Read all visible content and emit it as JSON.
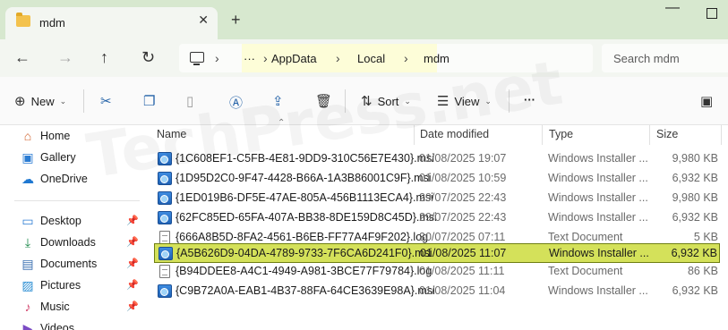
{
  "window": {
    "tab_title": "mdm",
    "close_tab": "✕",
    "new_tab": "+",
    "minimize": "—"
  },
  "nav": {
    "back": "←",
    "forward": "→",
    "up": "↑",
    "refresh": "↻",
    "breadcrumb": [
      "AppData",
      "Local",
      "mdm"
    ],
    "more": "···",
    "search_placeholder": "Search mdm"
  },
  "toolbar": {
    "new_label": "New",
    "sort_label": "Sort",
    "view_label": "View",
    "more": "···"
  },
  "sidebar": {
    "items": [
      {
        "label": "Home",
        "icon": "home-icon"
      },
      {
        "label": "Gallery",
        "icon": "gallery-icon"
      },
      {
        "label": "OneDrive",
        "icon": "cloud-icon"
      },
      {
        "label": "Desktop",
        "icon": "desktop-icon"
      },
      {
        "label": "Downloads",
        "icon": "download-icon"
      },
      {
        "label": "Documents",
        "icon": "document-icon"
      },
      {
        "label": "Pictures",
        "icon": "pictures-icon"
      },
      {
        "label": "Music",
        "icon": "music-icon"
      },
      {
        "label": "Videos",
        "icon": "videos-icon"
      }
    ]
  },
  "columns": {
    "name": "Name",
    "date": "Date modified",
    "type": "Type",
    "size": "Size"
  },
  "files": [
    {
      "name": "{1C608EF1-C5FB-4E81-9DD9-310C56E7E430}.msi",
      "date": "01/08/2025 19:07",
      "type": "Windows Installer ...",
      "size": "9,980 KB",
      "kind": "msi"
    },
    {
      "name": "{1D95D2C0-9F47-4428-B66A-1A3B86001C9F}.msi",
      "date": "01/08/2025 10:59",
      "type": "Windows Installer ...",
      "size": "6,932 KB",
      "kind": "msi"
    },
    {
      "name": "{1ED019B6-DF5E-47AE-805A-456B1113ECA4}.msi",
      "date": "29/07/2025 22:43",
      "type": "Windows Installer ...",
      "size": "9,980 KB",
      "kind": "msi"
    },
    {
      "name": "{62FC85ED-65FA-407A-BB38-8DE159D8C45D}.msi",
      "date": "29/07/2025 22:43",
      "type": "Windows Installer ...",
      "size": "6,932 KB",
      "kind": "msi"
    },
    {
      "name": "{666A8B5D-8FA2-4561-B6EB-FF77A4F9F202}.log",
      "date": "30/07/2025 07:11",
      "type": "Text Document",
      "size": "5 KB",
      "kind": "log"
    },
    {
      "name": "{A5B626D9-04DA-4789-9733-7F6CA6D241F0}.msi",
      "date": "01/08/2025 11:07",
      "type": "Windows Installer ...",
      "size": "6,932 KB",
      "kind": "msi",
      "selected": true
    },
    {
      "name": "{B94DDEE8-A4C1-4949-A981-3BCE77F79784}.log",
      "date": "01/08/2025 11:11",
      "type": "Text Document",
      "size": "86 KB",
      "kind": "log"
    },
    {
      "name": "{C9B72A0A-EAB1-4B37-88FA-64CE3639E98A}.msi",
      "date": "01/08/2025 11:04",
      "type": "Windows Installer ...",
      "size": "6,932 KB",
      "kind": "msi"
    }
  ],
  "watermark": "TechPress.net"
}
